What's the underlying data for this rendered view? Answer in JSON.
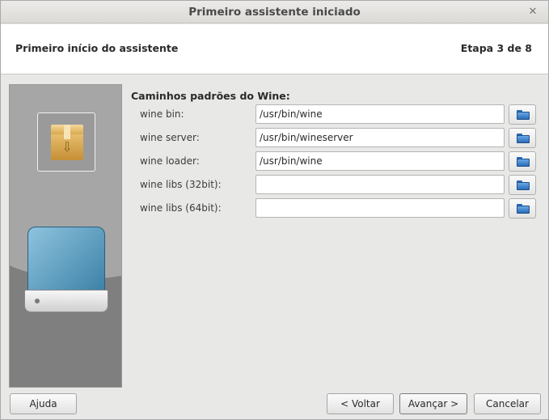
{
  "window": {
    "title": "Primeiro assistente iniciado",
    "close_glyph": "✕"
  },
  "header": {
    "title": "Primeiro início do assistente",
    "step": "Etapa 3 de 8"
  },
  "side_panel": {
    "package_icon": "package-box-icon",
    "drive_icon": "hard-drive-icon"
  },
  "content": {
    "section_title": "Caminhos padrões do Wine:",
    "rows": [
      {
        "label": "wine bin:",
        "value": "/usr/bin/wine"
      },
      {
        "label": "wine server:",
        "value": "/usr/bin/wineserver"
      },
      {
        "label": "wine loader:",
        "value": "/usr/bin/wine"
      },
      {
        "label": "wine libs (32bit):",
        "value": ""
      },
      {
        "label": "wine libs (64bit):",
        "value": ""
      }
    ],
    "browse_icon": "folder-icon"
  },
  "footer": {
    "help": "Ajuda",
    "back": "< Voltar",
    "next": "Avançar >",
    "cancel": "Cancelar"
  }
}
